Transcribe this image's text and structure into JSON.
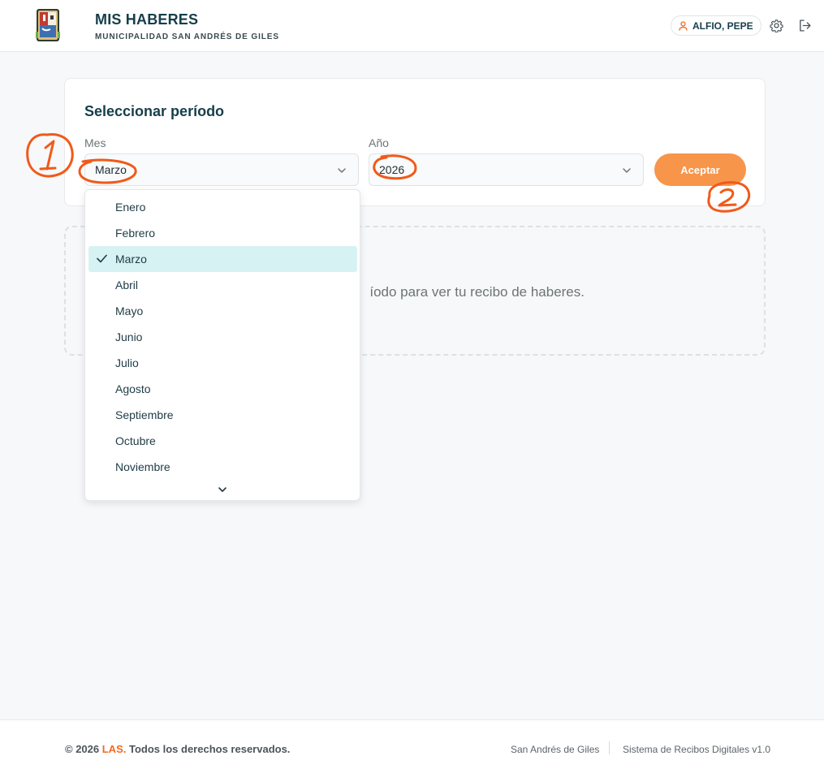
{
  "header": {
    "title": "MIS HABERES",
    "subtitle": "MUNICIPALIDAD SAN ANDRÉS DE GILES",
    "user_name": "ALFIO, PEPE"
  },
  "period": {
    "title": "Seleccionar período",
    "month_label": "Mes",
    "month_value": "Marzo",
    "year_label": "Año",
    "year_value": "2026",
    "accept_label": "Aceptar"
  },
  "empty_state": {
    "message": "íodo para ver tu recibo de haberes."
  },
  "month_dropdown": {
    "options": [
      "Enero",
      "Febrero",
      "Marzo",
      "Abril",
      "Mayo",
      "Junio",
      "Julio",
      "Agosto",
      "Septiembre",
      "Octubre",
      "Noviembre"
    ],
    "selected": "Marzo"
  },
  "annotations": {
    "color": "#f05a1a",
    "labels": [
      "1",
      "2"
    ]
  },
  "footer": {
    "copyright_prefix": "© 2026 ",
    "copyright_brand": "LAS.",
    "copyright_suffix": " Todos los derechos reservados.",
    "location": "San Andrés de Giles",
    "system": "Sistema de Recibos Digitales v1.0"
  },
  "colors": {
    "primary": "#163e4a",
    "accent": "#f7954a",
    "selected_bg": "#d7f2f3",
    "brand": "#f06a22"
  },
  "icons": [
    "municipal-shield-logo",
    "user-icon",
    "gear-icon",
    "logout-icon",
    "chevron-down-icon",
    "check-icon"
  ]
}
